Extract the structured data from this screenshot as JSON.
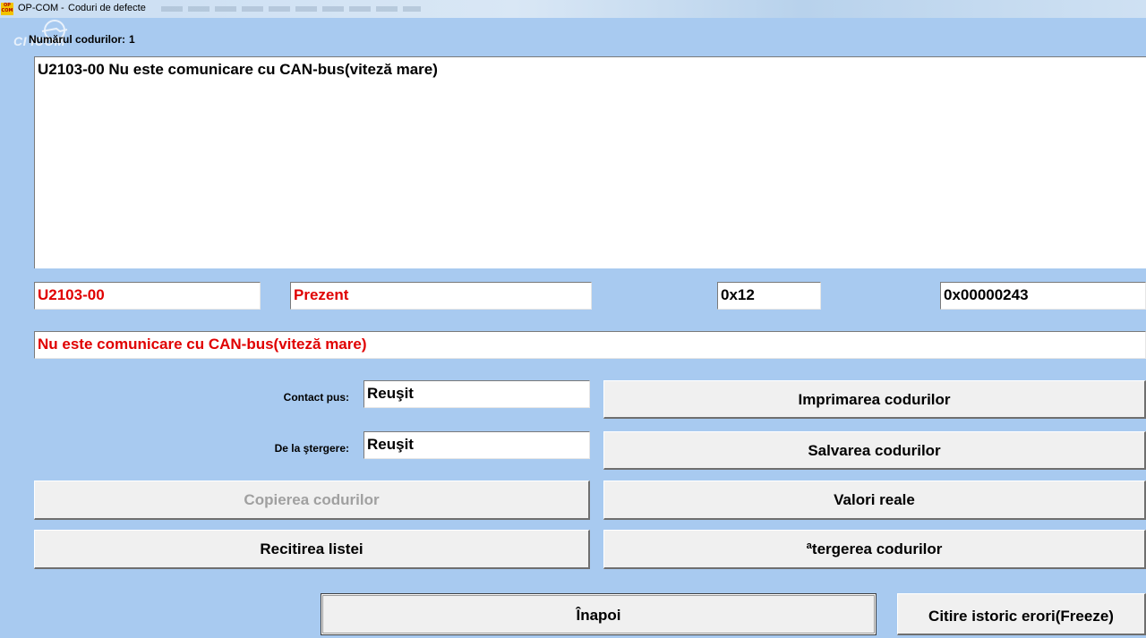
{
  "window": {
    "app_name": "OP-COM",
    "separator": "-",
    "title": "Coduri de defecte",
    "icon_text_top": "OP",
    "icon_text_bottom": "COM"
  },
  "watermark": {
    "text": "CI  ICOM"
  },
  "codes": {
    "count_label": "Numărul codurilor:",
    "count_value": "1",
    "list": [
      "U2103-00 Nu este comunicare cu CAN-bus(viteză mare)"
    ]
  },
  "detail": {
    "code": "U2103-00",
    "status": "Prezent",
    "hex1": "0x12",
    "hex2": "0x00000243",
    "description": "Nu este comunicare cu CAN-bus(viteză mare)"
  },
  "results": {
    "contact_label": "Contact pus:",
    "contact_value": "Reuşit",
    "delete_label": "De la ştergere:",
    "delete_value": "Reuşit"
  },
  "buttons": {
    "print": "Imprimarea codurilor",
    "save": "Salvarea codurilor",
    "copy": "Copierea codurilor",
    "real_values": "Valori reale",
    "reread": "Recitirea listei",
    "delete": "ªtergerea codurilor",
    "back": "Înapoi",
    "freeze": "Citire istoric erori(Freeze)"
  },
  "colors": {
    "background": "#a8caf0",
    "error_text": "#e00000",
    "disabled_text": "#a0a0a0"
  }
}
